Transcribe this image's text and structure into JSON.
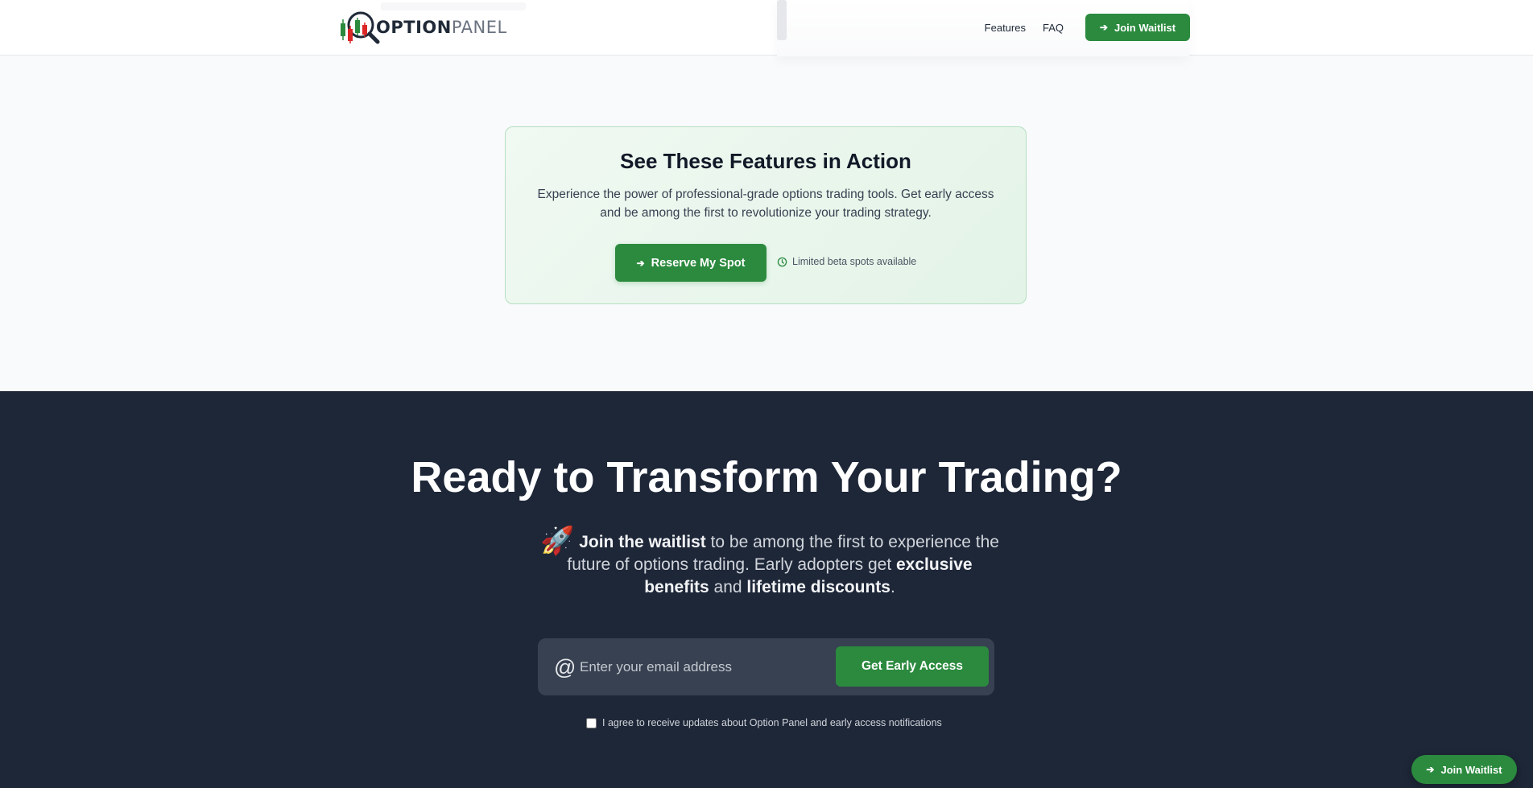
{
  "header": {
    "logo_strong": "OPTION",
    "logo_light": "PANEL",
    "nav": {
      "features": "Features",
      "faq": "FAQ"
    },
    "join_label": "Join Waitlist"
  },
  "feature_cta": {
    "title": "See These Features in Action",
    "description": "Experience the power of professional-grade options trading tools. Get early access and be among the first to revolutionize your trading strategy.",
    "button_label": "Reserve My Spot",
    "beta_note": "Limited beta spots available"
  },
  "final_cta": {
    "title": "Ready to Transform Your Trading?",
    "desc": {
      "emoji": "🚀",
      "b1": "Join the waitlist",
      "t1": " to be among the first to experience the future of options trading. Early adopters get ",
      "b2": "exclusive benefits",
      "t2": " and ",
      "b3": "lifetime discounts",
      "t3": "."
    },
    "email": {
      "icon": "@",
      "placeholder": "Enter your email address",
      "value": ""
    },
    "button_label": "Get Early Access",
    "consent_label": "I agree to receive updates about Option Panel and early access notifications",
    "consent_checked": false
  },
  "floating_button": {
    "label": "Join Waitlist"
  },
  "colors": {
    "brand_green": "#2b8a3e",
    "dark_bg": "#1e2738",
    "light_bg": "#f8fafc",
    "card_border": "#b7dfc0"
  },
  "icons": {
    "arrow": "arrow-right-icon",
    "clock": "clock-icon",
    "at": "at-icon",
    "rocket": "rocket-icon",
    "logo": "magnifier-candlestick-logo"
  }
}
